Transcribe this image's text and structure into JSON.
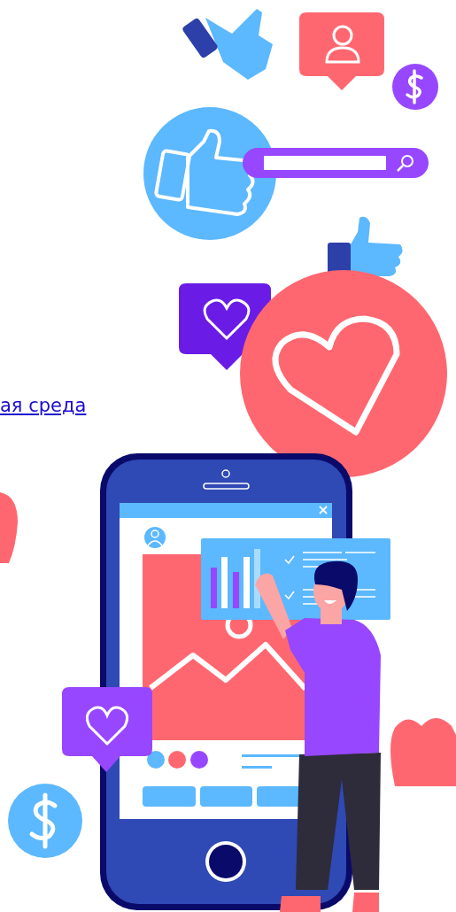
{
  "link": {
    "text": "ая среда"
  }
}
